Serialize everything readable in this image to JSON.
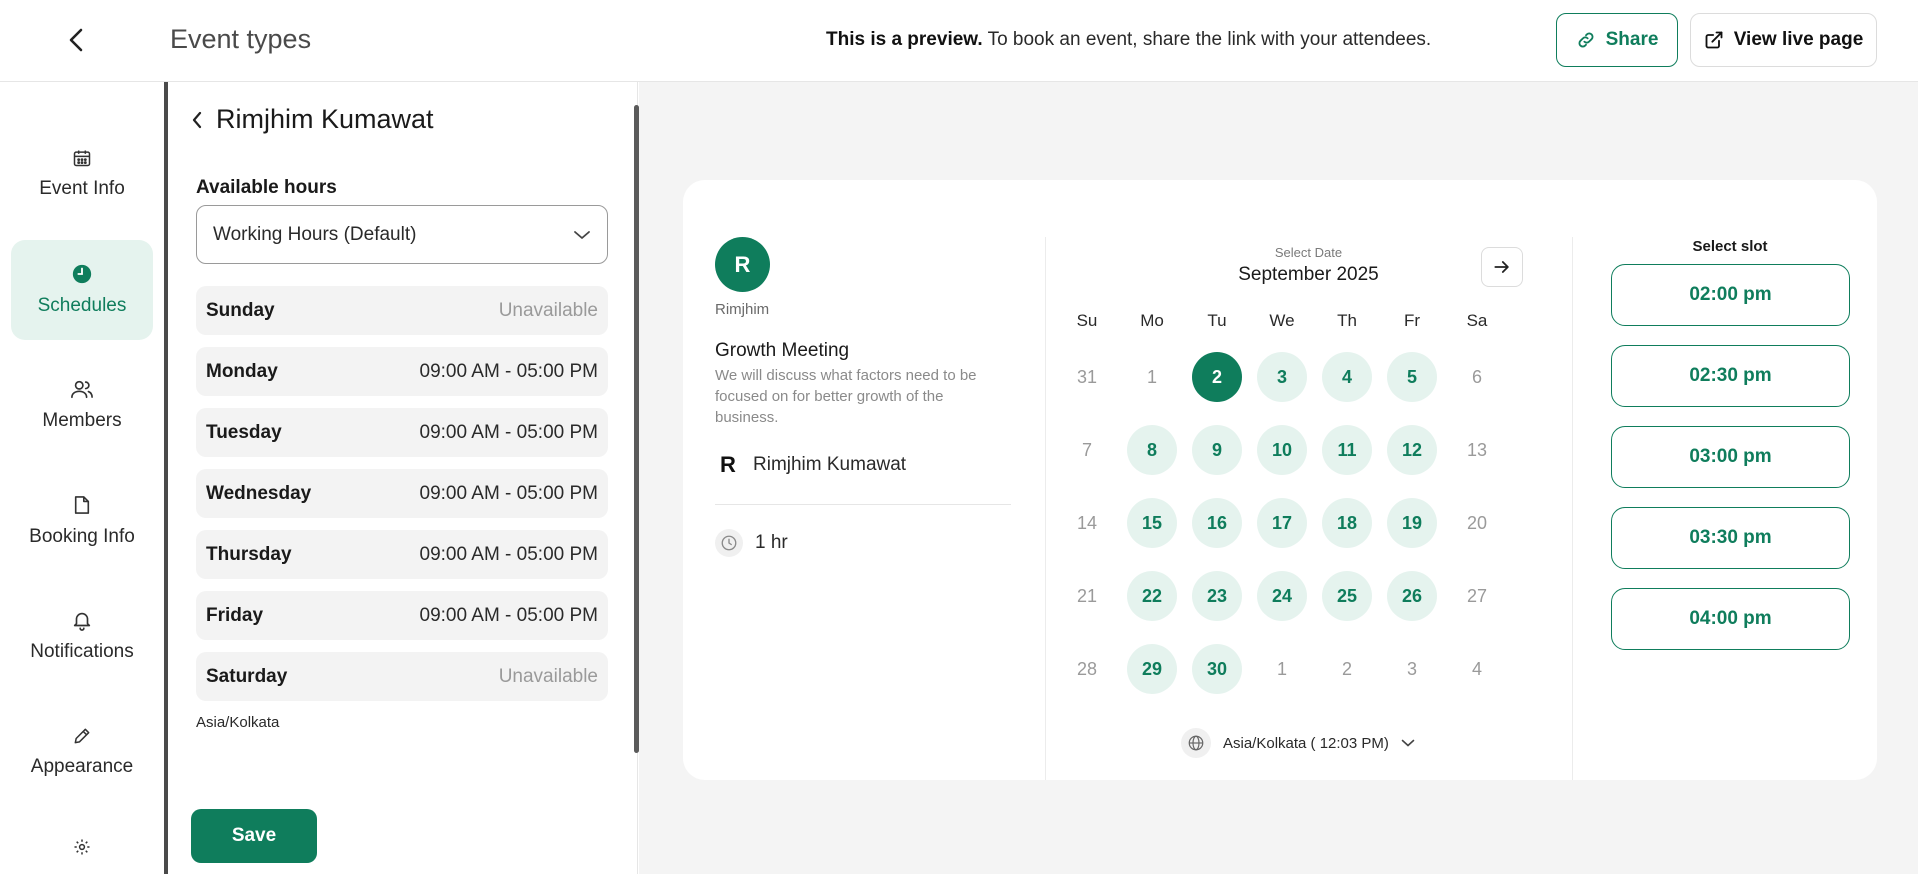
{
  "header": {
    "title": "Event types",
    "preview_bold": "This is a preview.",
    "preview_text": " To book an event, share the link with your attendees.",
    "share_label": "Share",
    "live_label": "View live page"
  },
  "sidenav": {
    "items": [
      {
        "label": "Event Info",
        "icon": "calendar-icon"
      },
      {
        "label": "Schedules",
        "icon": "clock-icon",
        "active": true
      },
      {
        "label": "Members",
        "icon": "users-icon"
      },
      {
        "label": "Booking Info",
        "icon": "file-icon"
      },
      {
        "label": "Notifications",
        "icon": "bell-icon"
      },
      {
        "label": "Appearance",
        "icon": "pencil-icon"
      },
      {
        "label": "",
        "icon": "gear-icon"
      }
    ]
  },
  "schedule": {
    "member_name": "Rimjhim Kumawat",
    "available_label": "Available hours",
    "selected_hours": "Working Hours (Default)",
    "days": [
      {
        "day": "Sunday",
        "hours": "Unavailable"
      },
      {
        "day": "Monday",
        "hours": "09:00 AM - 05:00 PM"
      },
      {
        "day": "Tuesday",
        "hours": "09:00 AM - 05:00 PM"
      },
      {
        "day": "Wednesday",
        "hours": "09:00 AM - 05:00 PM"
      },
      {
        "day": "Thursday",
        "hours": "09:00 AM - 05:00 PM"
      },
      {
        "day": "Friday",
        "hours": "09:00 AM - 05:00 PM"
      },
      {
        "day": "Saturday",
        "hours": "Unavailable"
      }
    ],
    "timezone": "Asia/Kolkata",
    "save_label": "Save"
  },
  "preview": {
    "avatar_initial": "R",
    "host_short": "Rimjhim",
    "event_title": "Growth Meeting",
    "event_desc": "We will discuss what factors need to be focused on for better growth of the business.",
    "host_initial": "R",
    "host_name": "Rimjhim Kumawat",
    "duration": "1 hr",
    "calendar": {
      "subtitle": "Select Date",
      "month": "September 2025",
      "weekdays": [
        "Su",
        "Mo",
        "Tu",
        "We",
        "Th",
        "Fr",
        "Sa"
      ],
      "weeks": [
        [
          "31",
          "1",
          "2",
          "3",
          "4",
          "5",
          "6"
        ],
        [
          "7",
          "8",
          "9",
          "10",
          "11",
          "12",
          "13"
        ],
        [
          "14",
          "15",
          "16",
          "17",
          "18",
          "19",
          "20"
        ],
        [
          "21",
          "22",
          "23",
          "24",
          "25",
          "26",
          "27"
        ],
        [
          "28",
          "29",
          "30",
          "1",
          "2",
          "3",
          "4"
        ]
      ],
      "states": [
        [
          "off",
          "off",
          "sel",
          "av",
          "av",
          "av",
          "off"
        ],
        [
          "off",
          "av",
          "av",
          "av",
          "av",
          "av",
          "off"
        ],
        [
          "off",
          "av",
          "av",
          "av",
          "av",
          "av",
          "off"
        ],
        [
          "off",
          "av",
          "av",
          "av",
          "av",
          "av",
          "off"
        ],
        [
          "off",
          "av",
          "av",
          "off",
          "off",
          "off",
          "off"
        ]
      ],
      "timezone_label": "Asia/Kolkata ( 12:03 PM)"
    },
    "slots_title": "Select slot",
    "slots": [
      "02:00 pm",
      "02:30 pm",
      "03:00 pm",
      "03:30 pm",
      "04:00 pm"
    ]
  },
  "colors": {
    "accent": "#0f7d5c",
    "accent_light": "#e5f3ee"
  }
}
